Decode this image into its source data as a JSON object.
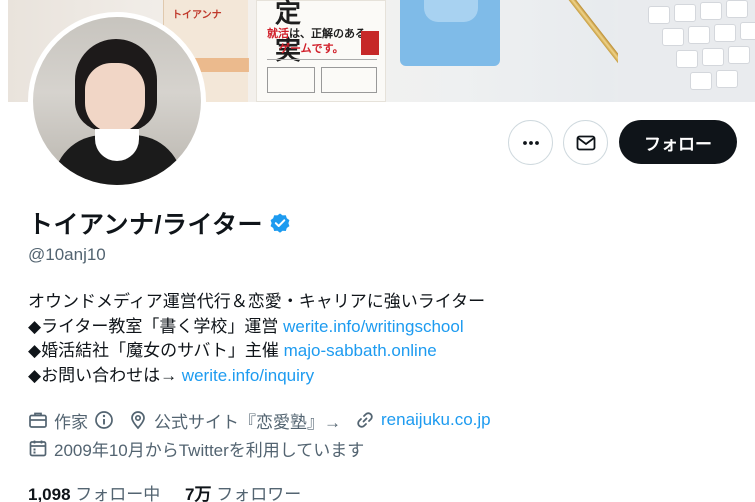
{
  "banner": {
    "book_label": "トイアンナ",
    "book_title": "定 実",
    "book_line1_a": "就活",
    "book_line1_b": "は、正解のある",
    "book_line2": "ゲームです。"
  },
  "profile": {
    "name": "トイアンナ/ライター",
    "handle": "@10anj10",
    "follow_label": "フォロー"
  },
  "bio": {
    "line1": "オウンドメディア運営代行＆恋愛・キャリアに強いライター",
    "line2_text": "◆ライター教室「書く学校」運営 ",
    "line2_link": "werite.info/writingschool",
    "line3_text": "◆婚活結社「魔女のサバト」主催 ",
    "line3_link": "majo-sabbath.online",
    "line4_text": "◆お問い合わせは→ ",
    "line4_link": "werite.info/inquiry"
  },
  "meta": {
    "category": "作家",
    "location": "公式サイト『恋愛塾』→",
    "website": "renaijuku.co.jp",
    "joined": "2009年10月からTwitterを利用しています"
  },
  "counts": {
    "following_num": "1,098",
    "following_label": "フォロー中",
    "followers_num": "7万",
    "followers_label": "フォロワー"
  },
  "colors": {
    "link": "#1d9bf0",
    "verified": "#1d9bf0",
    "follow_bg": "#0f1419",
    "secondary_text": "#536471"
  }
}
